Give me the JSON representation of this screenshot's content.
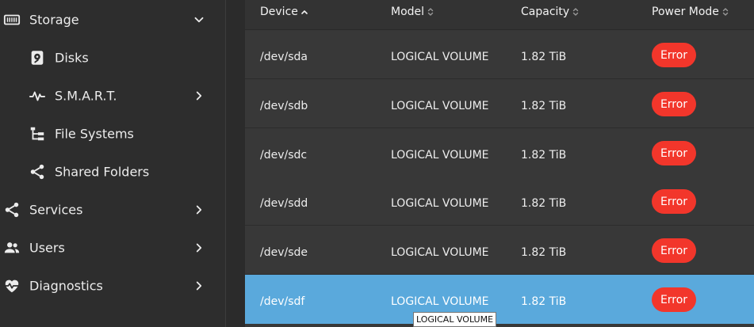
{
  "sidebar": {
    "items": [
      {
        "label": "Storage",
        "icon": "storage-icon",
        "expanded": true
      },
      {
        "label": "Disks",
        "icon": "disk-icon"
      },
      {
        "label": "S.M.A.R.T.",
        "icon": "pulse-icon"
      },
      {
        "label": "File Systems",
        "icon": "file-tree-icon"
      },
      {
        "label": "Shared Folders",
        "icon": "share-icon"
      },
      {
        "label": "Services",
        "icon": "share-icon"
      },
      {
        "label": "Users",
        "icon": "users-icon"
      },
      {
        "label": "Diagnostics",
        "icon": "heart-pulse-icon"
      }
    ]
  },
  "table": {
    "columns": [
      {
        "label": "Device",
        "sort": "ascending"
      },
      {
        "label": "Model",
        "sort": "none"
      },
      {
        "label": "Capacity",
        "sort": "none"
      },
      {
        "label": "Power Mode",
        "sort": "none"
      }
    ],
    "rows": [
      {
        "device": "/dev/sda",
        "model": "LOGICAL VOLUME",
        "capacity": "1.82 TiB",
        "power_mode": "Error"
      },
      {
        "device": "/dev/sdb",
        "model": "LOGICAL VOLUME",
        "capacity": "1.82 TiB",
        "power_mode": "Error"
      },
      {
        "device": "/dev/sdc",
        "model": "LOGICAL VOLUME",
        "capacity": "1.82 TiB",
        "power_mode": "Error"
      },
      {
        "device": "/dev/sdd",
        "model": "LOGICAL VOLUME",
        "capacity": "1.82 TiB",
        "power_mode": "Error"
      },
      {
        "device": "/dev/sde",
        "model": "LOGICAL VOLUME",
        "capacity": "1.82 TiB",
        "power_mode": "Error"
      },
      {
        "device": "/dev/sdf",
        "model": "LOGICAL VOLUME",
        "capacity": "1.82 TiB",
        "power_mode": "Error",
        "selected": true
      }
    ]
  },
  "tooltip": {
    "text": "LOGICAL VOLUME"
  },
  "colors": {
    "sidebar_bg": "#2d2d2d",
    "row_bg": "#383838",
    "selected_row": "#5aa9dc",
    "error_badge": "#f2362b",
    "text": "#ececec"
  }
}
